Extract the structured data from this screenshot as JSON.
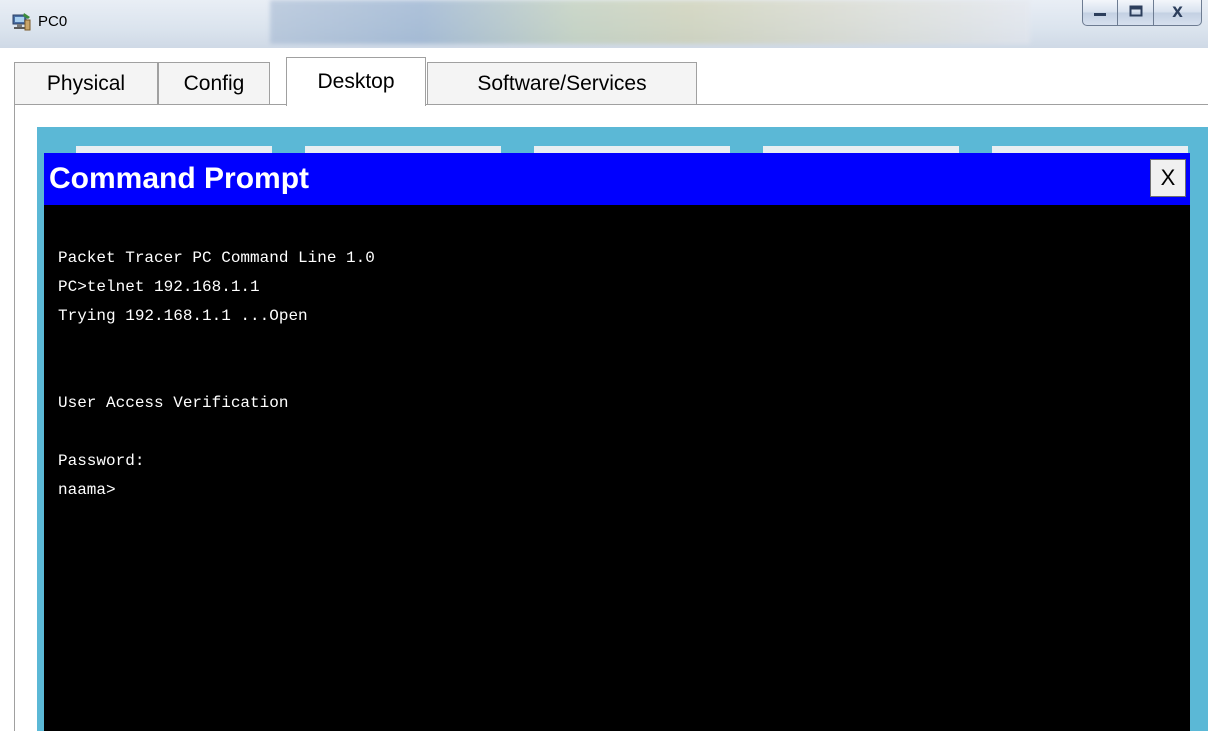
{
  "window": {
    "title": "PC0",
    "icon": "pc-device-icon",
    "controls": [
      "minimize-icon",
      "maximize-icon",
      "close-icon"
    ],
    "close_label": "X"
  },
  "tabs": [
    {
      "label": "Physical",
      "active": false
    },
    {
      "label": "Config",
      "active": false
    },
    {
      "label": "Desktop",
      "active": true
    },
    {
      "label": "Software/Services",
      "active": false
    }
  ],
  "command_prompt": {
    "title": "Command Prompt",
    "close_label": "X",
    "lines": [
      "Packet Tracer PC Command Line 1.0",
      "PC>telnet 192.168.1.1",
      "Trying 192.168.1.1 ...Open",
      "",
      "",
      "User Access Verification",
      "",
      "Password: ",
      "naama>"
    ]
  },
  "colors": {
    "cmd_header": "#0000ff",
    "terminal_bg": "#000000",
    "terminal_text": "#ffffff",
    "desktop_frame": "#5bb8d6"
  }
}
